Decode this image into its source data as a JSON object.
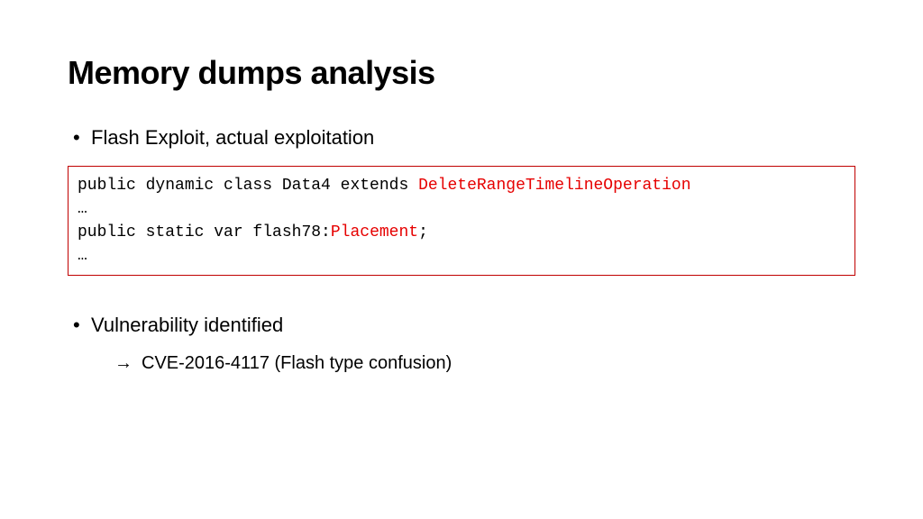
{
  "title": "Memory dumps analysis",
  "bullets": {
    "b1": "Flash Exploit, actual exploitation",
    "b2": "Vulnerability identified"
  },
  "code": {
    "l1a": "public dynamic class Data4 extends ",
    "l1b": "DeleteRangeTimelineOperation",
    "l2": "…",
    "l3a": "public static var flash78:",
    "l3b": "Placement",
    "l3c": ";",
    "l4": "…"
  },
  "sub": {
    "arrow": "→",
    "text": "CVE-2016-4117 (Flash type confusion)"
  },
  "glyphs": {
    "dot": "•"
  }
}
